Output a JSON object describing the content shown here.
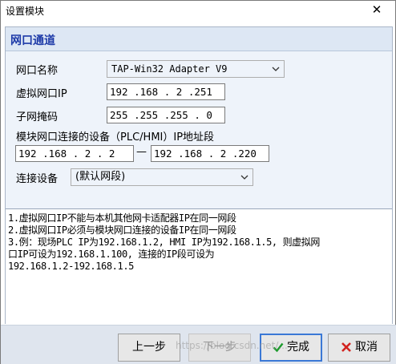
{
  "window": {
    "title": "设置模块",
    "close_glyph": "✕"
  },
  "section": {
    "title": "网口通道"
  },
  "form": {
    "adapter_label": "网口名称",
    "adapter_value": "TAP-Win32 Adapter V9",
    "virtual_ip_label": "虚拟网口IP",
    "virtual_ip_value": "192 .168 . 2 .251",
    "subnet_label": "子网掩码",
    "subnet_value": "255 .255 .255 . 0",
    "range_label": "模块网口连接的设备（PLC/HMI）IP地址段",
    "range_start": "192 .168 . 2 . 2",
    "range_sep": "—",
    "range_end": "192 .168 . 2 .220",
    "device_label": "连接设备",
    "device_value": "(默认网段)"
  },
  "notes": {
    "line1": "1.虚拟网口IP不能与本机其他网卡适配器IP在同一网段",
    "line2": "2.虚拟网口IP必须与模块网口连接的设备IP在同一网段",
    "line3": "3.例：现场PLC IP为192.168.1.2, HMI IP为192.168.1.5, 则虚拟网",
    "line4": "口IP可设为192.168.1.100, 连接的IP段可设为",
    "line5": "192.168.1.2-192.168.1.5"
  },
  "buttons": {
    "prev": "上一步",
    "next": "下一步",
    "finish": "完成",
    "cancel": "取消"
  },
  "watermark": "https://blog.csdn.net/...",
  "colors": {
    "accent": "#3a78d6",
    "section_title": "#1d3aa8",
    "panel": "#eef3fa"
  }
}
